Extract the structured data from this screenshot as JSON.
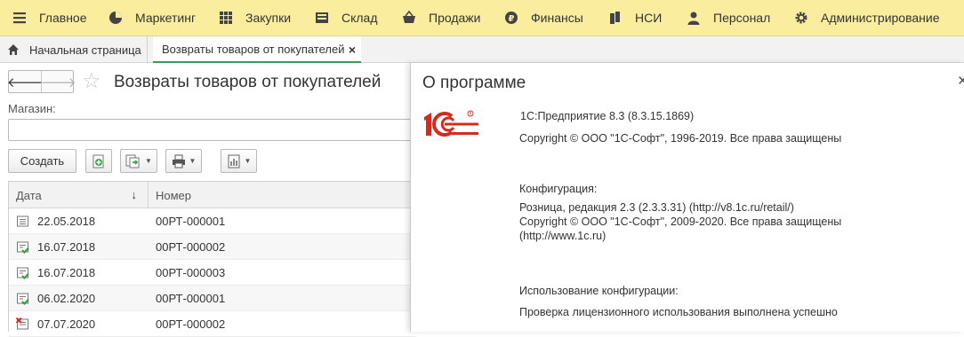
{
  "menu": [
    {
      "label": "Главное",
      "icon": "hamburger-icon"
    },
    {
      "label": "Маркетинг",
      "icon": "pie-chart-icon"
    },
    {
      "label": "Закупки",
      "icon": "grid-icon"
    },
    {
      "label": "Склад",
      "icon": "warehouse-icon"
    },
    {
      "label": "Продажи",
      "icon": "basket-icon"
    },
    {
      "label": "Финансы",
      "icon": "ruble-coin-icon"
    },
    {
      "label": "НСИ",
      "icon": "books-icon"
    },
    {
      "label": "Персонал",
      "icon": "person-icon"
    },
    {
      "label": "Администрирование",
      "icon": "gear-icon"
    }
  ],
  "tabs": {
    "home": "Начальная страница",
    "active": "Возвраты товаров от покупателей",
    "close": "×"
  },
  "form": {
    "title": "Возвраты товаров от покупателей",
    "back": "🡐",
    "forward": "🡒",
    "star": "☆",
    "store_label": "Магазин:",
    "store_value": "",
    "create_label": "Создать",
    "columns": {
      "date": "Дата",
      "number": "Номер",
      "sort": "↓"
    },
    "rows": [
      {
        "date": "22.05.2018",
        "number": "00РТ-000001",
        "status": "draft"
      },
      {
        "date": "16.07.2018",
        "number": "00РТ-000002",
        "status": "posted"
      },
      {
        "date": "16.07.2018",
        "number": "00РТ-000003",
        "status": "posted"
      },
      {
        "date": "06.02.2020",
        "number": "00РТ-000001",
        "status": "posted"
      },
      {
        "date": "07.07.2020",
        "number": "00РТ-000002",
        "status": "deleted"
      }
    ]
  },
  "about": {
    "title": "О программе",
    "close": "×",
    "logo_text": "1С",
    "platform": "1С:Предприятие 8.3 (8.3.15.1869)",
    "platform_copyright": "Copyright © ООО \"1С-Софт\", 1996-2019. Все права защищены",
    "config_label": "Конфигурация:",
    "config_name": "Розница, редакция 2.3 (2.3.3.31) (http://v8.1c.ru/retail/)",
    "config_copyright": "Copyright © ООО \"1С-Софт\", 2009-2020. Все права защищены",
    "config_url": "(http://www.1c.ru)",
    "usage_label": "Использование конфигурации:",
    "usage_status": "Проверка лицензионного использования выполнена успешно"
  },
  "colors": {
    "menu_bg": "#fbed9e",
    "accent": "#3c9a5f",
    "logo_red": "#d52b1e"
  }
}
